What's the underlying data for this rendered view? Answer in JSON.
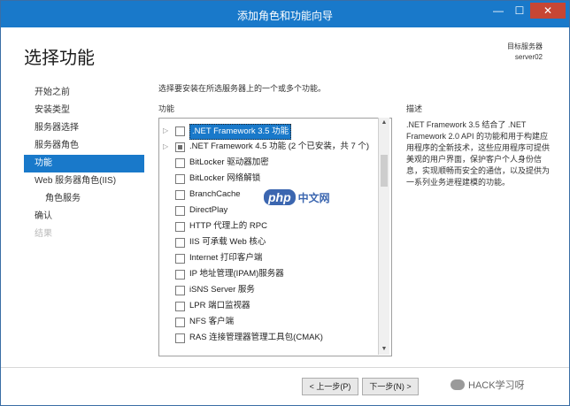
{
  "window": {
    "title": "添加角色和功能向导",
    "controls": [
      "—",
      "☐",
      "✕"
    ]
  },
  "header": {
    "page_title": "选择功能",
    "dest_label": "目标服务器",
    "dest_server": "server02"
  },
  "nav": {
    "items": [
      {
        "label": "开始之前"
      },
      {
        "label": "安装类型"
      },
      {
        "label": "服务器选择"
      },
      {
        "label": "服务器角色"
      },
      {
        "label": "功能"
      },
      {
        "label": "Web 服务器角色(IIS)"
      },
      {
        "label": "角色服务"
      },
      {
        "label": "确认"
      },
      {
        "label": "结果"
      }
    ]
  },
  "main": {
    "instruction": "选择要安装在所选服务器上的一个或多个功能。",
    "features_label": "功能",
    "features": [
      {
        "label": ".NET Framework 3.5 功能",
        "state": "unchecked",
        "expandable": true,
        "selected": true
      },
      {
        "label": ".NET Framework 4.5 功能 (2 个已安装，共 7 个)",
        "state": "partial",
        "expandable": true
      },
      {
        "label": "BitLocker 驱动器加密",
        "state": "unchecked"
      },
      {
        "label": "BitLocker 网络解锁",
        "state": "unchecked"
      },
      {
        "label": "BranchCache",
        "state": "unchecked"
      },
      {
        "label": "DirectPlay",
        "state": "unchecked"
      },
      {
        "label": "HTTP 代理上的 RPC",
        "state": "unchecked"
      },
      {
        "label": "IIS 可承载 Web 核心",
        "state": "unchecked"
      },
      {
        "label": "Internet 打印客户端",
        "state": "unchecked"
      },
      {
        "label": "IP 地址管理(IPAM)服务器",
        "state": "unchecked"
      },
      {
        "label": "iSNS Server 服务",
        "state": "unchecked"
      },
      {
        "label": "LPR 端口监视器",
        "state": "unchecked"
      },
      {
        "label": "NFS 客户端",
        "state": "unchecked"
      },
      {
        "label": "RAS 连接管理器管理工具包(CMAK)",
        "state": "unchecked"
      }
    ],
    "description_label": "描述",
    "description": ".NET Framework 3.5 结合了 .NET Framework 2.0 API 的功能和用于构建应用程序的全新技术，这些应用程序可提供美观的用户界面，保护客户个人身份信息，实现顺畅而安全的通信，以及提供为一系列业务进程建模的功能。"
  },
  "footer": {
    "prev_label": "< 上一步(P)",
    "next_label": "下一步(N) >"
  },
  "watermarks": {
    "php_logo": "php",
    "php_cn": "中文网",
    "hack": "HACK学习呀"
  }
}
